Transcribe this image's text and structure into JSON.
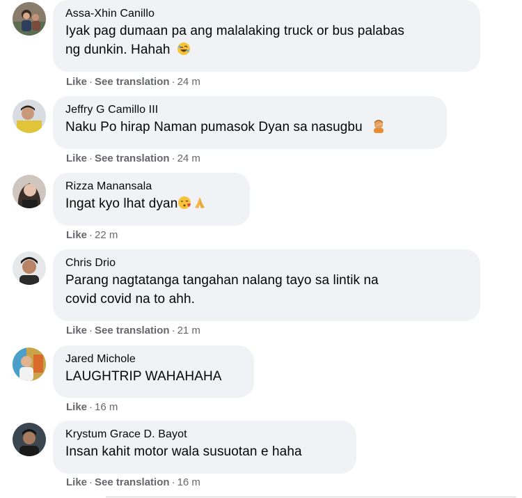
{
  "comments": [
    {
      "author": "Assa-Xhin Canillo",
      "line1": "Iyak pag dumaan pa ang malalaking truck or bus palabas",
      "line2": "ng dunkin. Hahah",
      "emoji": "rofl-emoji-icon",
      "like": "Like",
      "translate": "See translation",
      "time": "24 m"
    },
    {
      "author": "Jeffry G Camillo III",
      "line1": "Naku Po hirap Naman pumasok Dyan sa nasugbu",
      "emoji": "facepalm-emoji-icon",
      "like": "Like",
      "translate": "See translation",
      "time": "24 m"
    },
    {
      "author": "Rizza Manansala",
      "line1": "Ingat kyo lhat dyan",
      "emoji": "kissing-heart-emoji-icon",
      "emoji2": "praying-hands-emoji-icon",
      "like": "Like",
      "time": "22 m"
    },
    {
      "author": "Chris Drio",
      "line1": "Parang nagtatanga tangahan nalang tayo sa lintik na",
      "line2": "covid covid na to ahh.",
      "like": "Like",
      "translate": "See translation",
      "time": "21 m"
    },
    {
      "author": "Jared Michole",
      "line1": "LAUGHTRIP WAHAHAHA",
      "like": "Like",
      "time": "16 m"
    },
    {
      "author": "Krystum Grace D. Bayot",
      "line1": "Insan kahit motor wala susuotan e haha",
      "like": "Like",
      "translate": "See translation",
      "time": "16 m"
    }
  ],
  "separator": "·",
  "colors": {
    "bubble": "#f0f2f5",
    "meta": "#65676b",
    "text": "#050505"
  }
}
